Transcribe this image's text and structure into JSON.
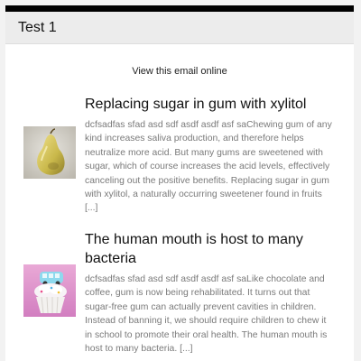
{
  "header": {
    "title": "Test 1"
  },
  "view_online": {
    "label": "View this email online"
  },
  "articles": [
    {
      "title": "Replacing sugar in gum with xylitol",
      "image_icon": "pear-photo",
      "body": "dcfsadfas sfad asd sdf asdf asdf asf saChewing gum of any kind increases saliva production, and therefore helps neutralize more acid. But many gums are sweetened with sugar, which of course increases the acid levels, effectively canceling out the positive benefits. Replacing sugar in gum with xylitol, a naturally occurring sweetener found in fruits ",
      "more": "[...]"
    },
    {
      "title": "The human mouth is host to many bacteria",
      "image_icon": "cupcake-with-toy-bus-photo",
      "body": "dcfsadfas sfad asd sdf asdf asdf asf saLike chocolate and coffee, gum is now being rehabilitated. It turns out that sugar-free gum can actually prevent cavities in children. Instead of banning it, we should require children to chew it in school to promote their oral health. The human mouth is host to many bacteria. ",
      "more": "[...]"
    }
  ],
  "colors": {
    "top_bar": "#000000",
    "header_background": "#ececec",
    "body_text": "#7a7a7a",
    "title_text": "#111111"
  }
}
